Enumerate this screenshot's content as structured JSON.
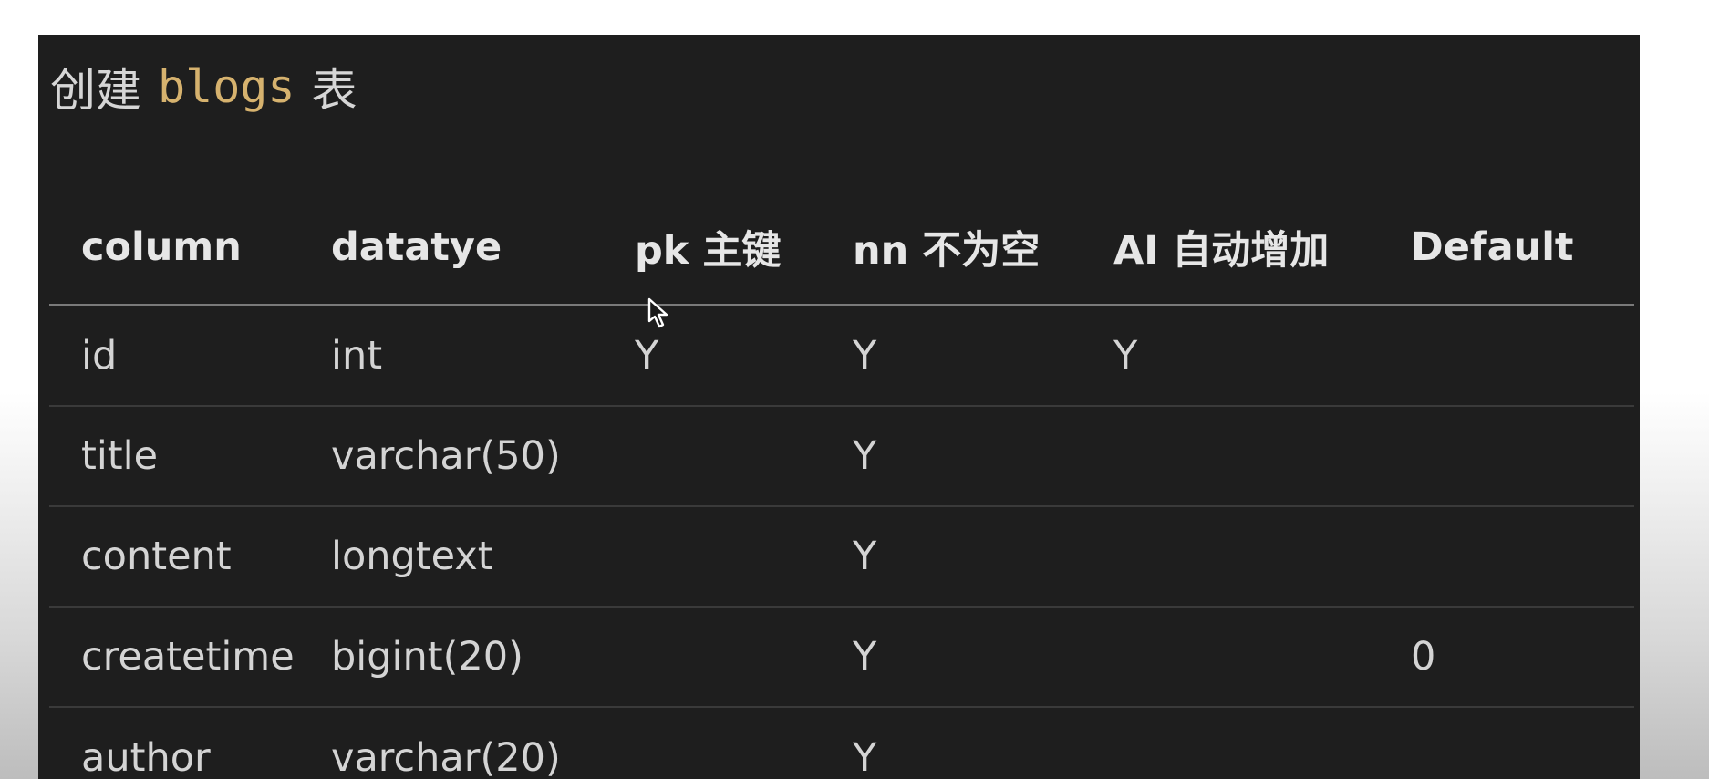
{
  "slide": {
    "title_prefix": "创建",
    "title_code": "blogs",
    "title_suffix": "表"
  },
  "table": {
    "headers": [
      "column",
      "datatye",
      "pk 主键",
      "nn 不为空",
      "AI 自动增加",
      "Default"
    ],
    "rows": [
      [
        "id",
        "int",
        "Y",
        "Y",
        "Y",
        ""
      ],
      [
        "title",
        "varchar(50)",
        "",
        "Y",
        "",
        ""
      ],
      [
        "content",
        "longtext",
        "",
        "Y",
        "",
        ""
      ],
      [
        "createtime",
        "bigint(20)",
        "",
        "Y",
        "",
        "0"
      ],
      [
        "author",
        "varchar(20)",
        "",
        "Y",
        "",
        ""
      ]
    ]
  },
  "colors": {
    "panel_bg": "#1e1e1e",
    "code_accent": "#d6b26e",
    "text": "#d4d4d4"
  },
  "icons": {
    "pointer": "mouse-pointer-icon"
  }
}
